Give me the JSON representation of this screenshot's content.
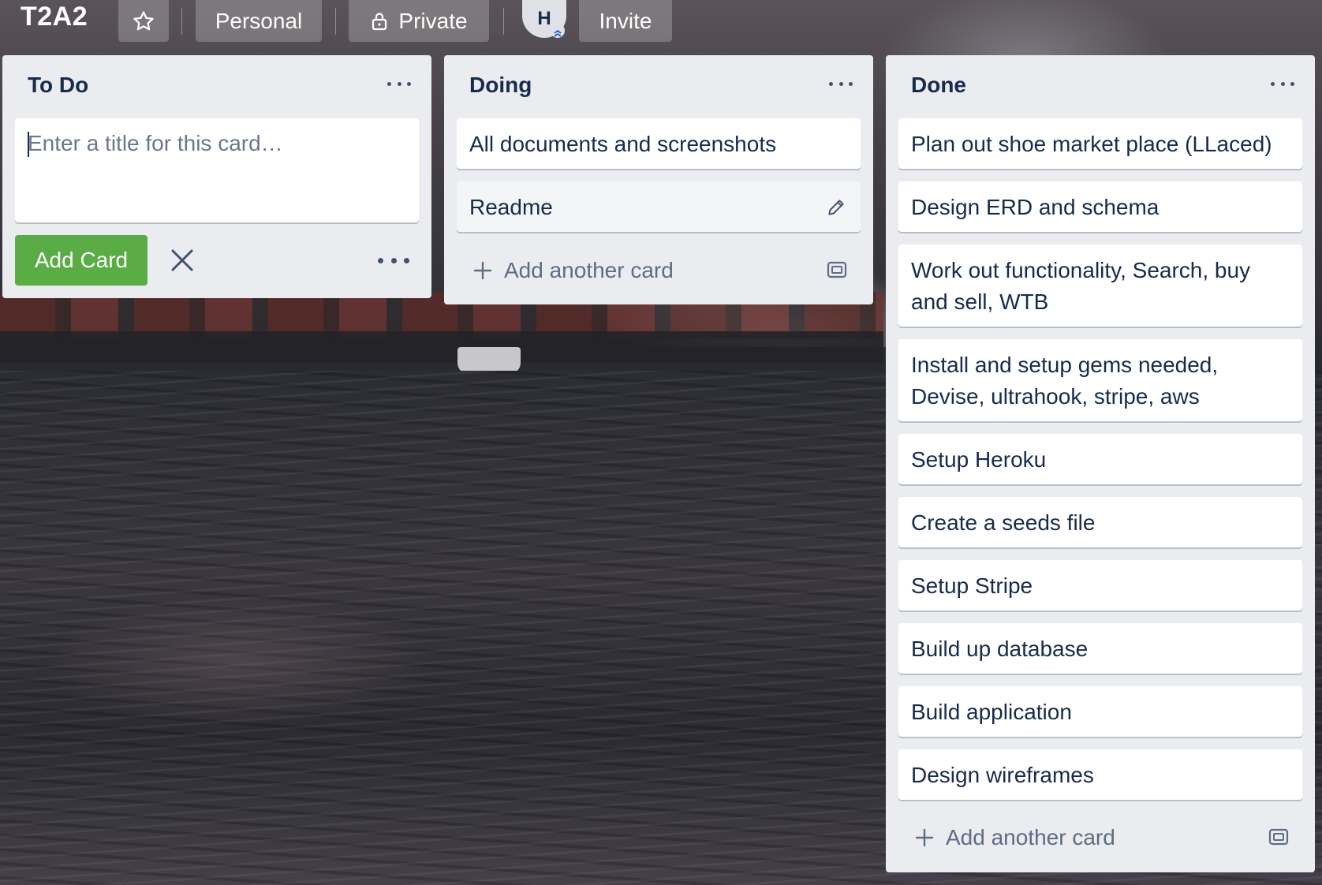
{
  "board": {
    "title": "T2A2",
    "visibility_team": "Personal",
    "visibility_privacy": "Private",
    "invite_label": "Invite",
    "member_initial": "H"
  },
  "lists": {
    "todo": {
      "title": "To Do",
      "composer_placeholder": "Enter a title for this card…",
      "add_button": "Add Card"
    },
    "doing": {
      "title": "Doing",
      "cards": [
        "All documents and screenshots",
        "Readme"
      ],
      "add_another": "Add another card"
    },
    "done": {
      "title": "Done",
      "cards": [
        "Plan out shoe market place (LLaced)",
        "Design ERD and schema",
        "Work out functionality, Search, buy and sell, WTB",
        "Install and setup gems needed, Devise, ultrahook, stripe, aws",
        "Setup Heroku",
        "Create a seeds file",
        "Setup Stripe",
        "Build up database",
        "Build application",
        "Design wireframes"
      ],
      "add_another": "Add another card"
    }
  },
  "colors": {
    "list_bg": "#ebecf0",
    "add_card_green": "#5aac44",
    "text_primary": "#172b4d",
    "text_muted": "#5e6c84"
  },
  "icons": [
    "star-icon",
    "lock-icon",
    "close-icon",
    "pencil-icon",
    "plus-icon",
    "card-template-icon",
    "ellipsis-icon"
  ]
}
